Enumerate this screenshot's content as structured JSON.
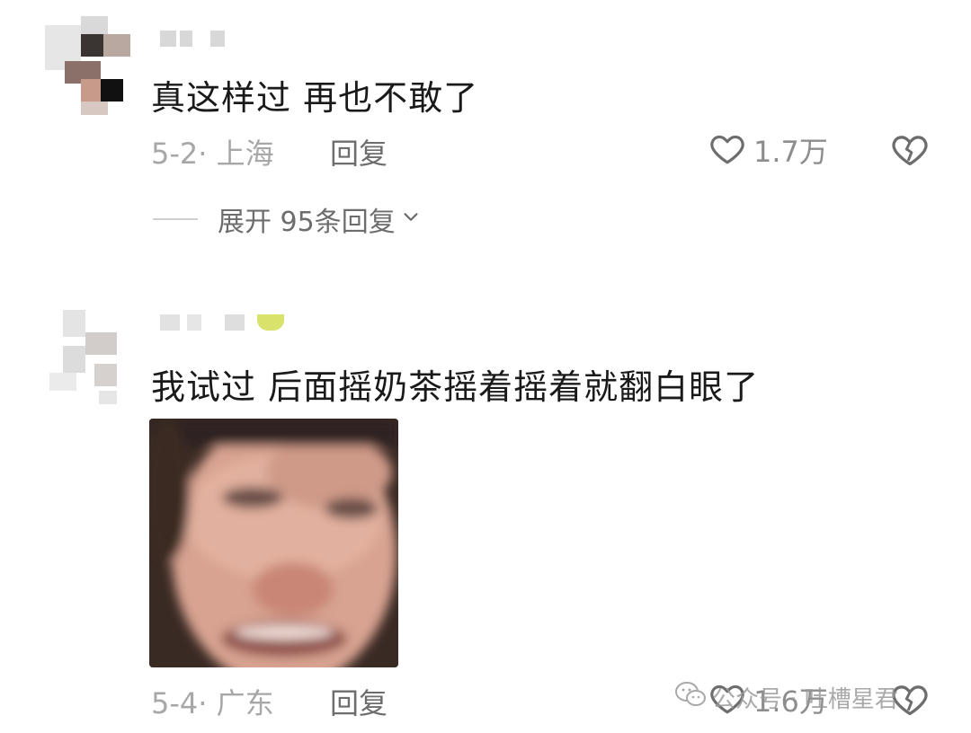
{
  "comments": [
    {
      "text": "真这样过 再也不敢了",
      "meta": "5-2· 上海",
      "reply_label": "回复",
      "like_count": "1.7万",
      "expand_label": "展开 95条回复"
    },
    {
      "text": "我试过 后面摇奶茶摇着摇着就翻白眼了",
      "meta": "5-4· 广东",
      "reply_label": "回复",
      "like_count": "1.6万"
    }
  ],
  "watermark": {
    "text": "公众号 · 吐槽星君"
  },
  "icons": {
    "like": "heart-outline-icon",
    "dislike": "broken-heart-icon",
    "expand": "chevron-down-icon",
    "watermark": "wechat-icon"
  },
  "colors": {
    "text": "#1a1a1a",
    "meta": "#a7a7a7",
    "action": "#6d6d6d"
  }
}
